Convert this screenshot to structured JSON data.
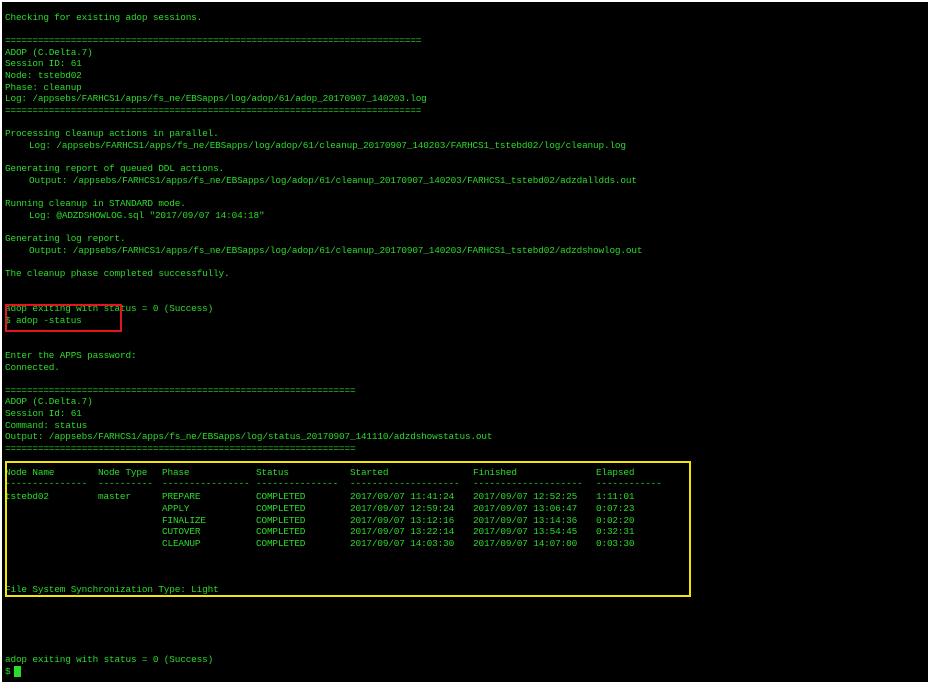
{
  "lines": {
    "checking": "Checking for existing adop sessions.",
    "sep1": "============================================================================",
    "adop_version": "ADOP (C.Delta.7)",
    "session_id": "Session ID: 61",
    "node": "Node: tstebd02",
    "phase": "Phase: cleanup",
    "log": "Log: /appsebs/FARHCS1/apps/fs_ne/EBSapps/log/adop/61/adop_20170907_140203.log",
    "sep2": "============================================================================",
    "processing": "Processing cleanup actions in parallel.",
    "processing_log": "Log: /appsebs/FARHCS1/apps/fs_ne/EBSapps/log/adop/61/cleanup_20170907_140203/FARHCS1_tstebd02/log/cleanup.log",
    "generating_ddl": "Generating report of queued DDL actions.",
    "ddl_output": "Output: /appsebs/FARHCS1/apps/fs_ne/EBSapps/log/adop/61/cleanup_20170907_140203/FARHCS1_tstebd02/adzdalldds.out",
    "running_cleanup": "Running cleanup in STANDARD mode.",
    "cleanup_log": "Log: @ADZDSHOWLOG.sql \"2017/09/07 14:04:18\"",
    "generating_log": "Generating log report.",
    "log_output": "Output: /appsebs/FARHCS1/apps/fs_ne/EBSapps/log/adop/61/cleanup_20170907_140203/FARHCS1_tstebd02/adzdshowlog.out",
    "completed": "The cleanup phase completed successfully.",
    "exit1": "adop exiting with status = 0 (Success)",
    "command": "$ adop -status",
    "enter_password": "Enter the APPS password:",
    "connected": "Connected.",
    "sep3": "================================================================",
    "status_version": "ADOP (C.Delta.7)",
    "status_session": "Session Id: 61",
    "status_command": "Command: status",
    "status_output": "Output: /appsebs/FARHCS1/apps/fs_ne/EBSapps/log/status_20170907_141110/adzdshowstatus.out",
    "sep4": "================================================================",
    "fs_sync": "File System Synchronization Type: Light",
    "exit2": "adop exiting with status = 0 (Success)",
    "prompt": "$"
  },
  "status_table": {
    "headers": [
      "Node Name",
      "Node Type",
      "Phase",
      "Status",
      "Started",
      "Finished",
      "Elapsed"
    ],
    "underlines": [
      "---------------",
      "----------",
      "----------------",
      "---------------",
      "--------------------",
      "--------------------",
      "------------"
    ],
    "rows": [
      [
        "tstebd02",
        "master",
        "PREPARE",
        "COMPLETED",
        "2017/09/07 11:41:24",
        "2017/09/07 12:52:25",
        "1:11:01"
      ],
      [
        "",
        "",
        "APPLY",
        "COMPLETED",
        "2017/09/07 12:59:24",
        "2017/09/07 13:06:47",
        "0:07:23"
      ],
      [
        "",
        "",
        "FINALIZE",
        "COMPLETED",
        "2017/09/07 13:12:16",
        "2017/09/07 13:14:36",
        "0:02:20"
      ],
      [
        "",
        "",
        "CUTOVER",
        "COMPLETED",
        "2017/09/07 13:22:14",
        "2017/09/07 13:54:45",
        "0:32:31"
      ],
      [
        "",
        "",
        "CLEANUP",
        "COMPLETED",
        "2017/09/07 14:03:30",
        "2017/09/07 14:07:00",
        "0:03:30"
      ]
    ]
  },
  "colors": {
    "background": "#000000",
    "text": "#2bdc2b",
    "highlight_command": "#e3161b",
    "highlight_status": "#f2e609"
  }
}
